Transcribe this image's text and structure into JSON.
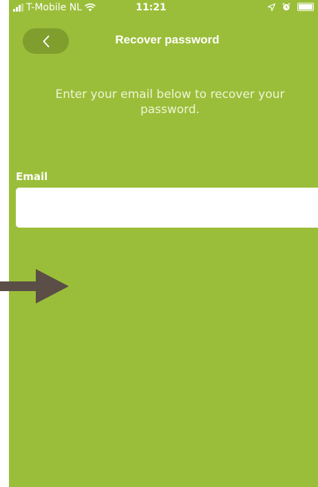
{
  "status_bar": {
    "carrier": "T-Mobile NL",
    "time": "11:21",
    "icons": [
      "signal-icon",
      "wifi-icon",
      "location-icon",
      "alarm-icon",
      "battery-icon"
    ]
  },
  "nav": {
    "back_icon": "chevron-left-icon",
    "title": "Recover password"
  },
  "form": {
    "instructions": "Enter your email below to recover your password.",
    "email_label": "Email",
    "email_value": "",
    "email_placeholder": ""
  },
  "colors": {
    "background": "#9bbe3a",
    "back_button": "#7f9e2d",
    "arrow": "#5a4e46"
  }
}
